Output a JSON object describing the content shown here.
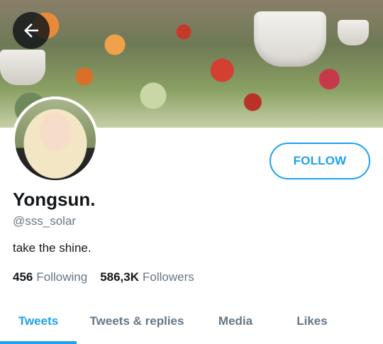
{
  "profile": {
    "display_name": "Yongsun.",
    "handle": "@sss_solar",
    "bio": "take the shine.",
    "following_count": "456",
    "following_label": "Following",
    "followers_count": "586,3K",
    "followers_label": "Followers"
  },
  "actions": {
    "follow_label": "FOLLOW"
  },
  "tabs": [
    {
      "label": "Tweets",
      "active": true
    },
    {
      "label": "Tweets & replies",
      "active": false
    },
    {
      "label": "Media",
      "active": false
    },
    {
      "label": "Likes",
      "active": false
    }
  ],
  "icons": {
    "back": "arrow-left-icon"
  },
  "colors": {
    "accent": "#1da1f2",
    "text_primary": "#14171a",
    "text_secondary": "#657786"
  }
}
